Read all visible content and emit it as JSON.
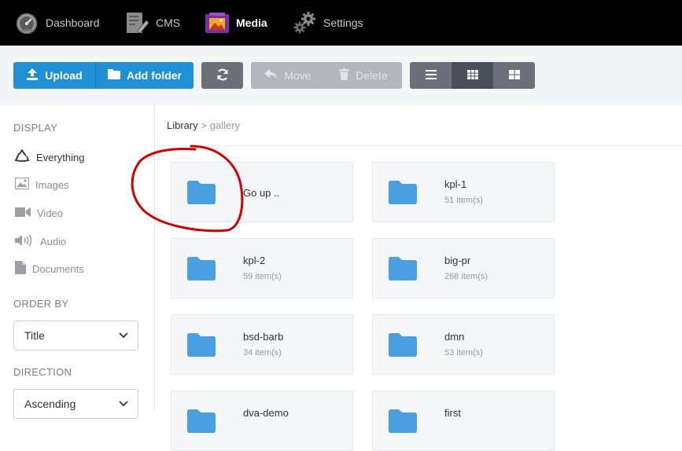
{
  "nav": {
    "items": [
      {
        "label": "Dashboard",
        "icon": "dashboard-icon"
      },
      {
        "label": "CMS",
        "icon": "cms-icon"
      },
      {
        "label": "Media",
        "icon": "media-icon",
        "active": true
      },
      {
        "label": "Settings",
        "icon": "settings-icon"
      }
    ]
  },
  "toolbar": {
    "upload_label": "Upload",
    "add_folder_label": "Add folder",
    "move_label": "Move",
    "delete_label": "Delete"
  },
  "sidebar": {
    "display_heading": "DISPLAY",
    "display_items": [
      {
        "label": "Everything",
        "icon": "recycle-icon",
        "active": true
      },
      {
        "label": "Images",
        "icon": "image-icon"
      },
      {
        "label": "Video",
        "icon": "video-icon"
      },
      {
        "label": "Audio",
        "icon": "audio-icon"
      },
      {
        "label": "Documents",
        "icon": "document-icon"
      }
    ],
    "order_heading": "ORDER BY",
    "order_value": "Title",
    "direction_heading": "DIRECTION",
    "direction_value": "Ascending"
  },
  "breadcrumb": {
    "root": "Library",
    "separator": ">",
    "current": "gallery"
  },
  "folders": [
    {
      "name": "Go up ..",
      "count": ""
    },
    {
      "name": "kpl-1",
      "count": "51 item(s)"
    },
    {
      "name": "kpl-2",
      "count": "59 item(s)"
    },
    {
      "name": "big-pr",
      "count": "268 item(s)"
    },
    {
      "name": "bsd-barb",
      "count": "34 item(s)"
    },
    {
      "name": "dmn",
      "count": "53 item(s)"
    },
    {
      "name": "dva-demo",
      "count": ""
    },
    {
      "name": "first",
      "count": ""
    }
  ],
  "colors": {
    "primary": "#1f8fd6",
    "folder": "#4a9fe0",
    "nav_bg": "#000000",
    "annotation": "#d40000"
  }
}
